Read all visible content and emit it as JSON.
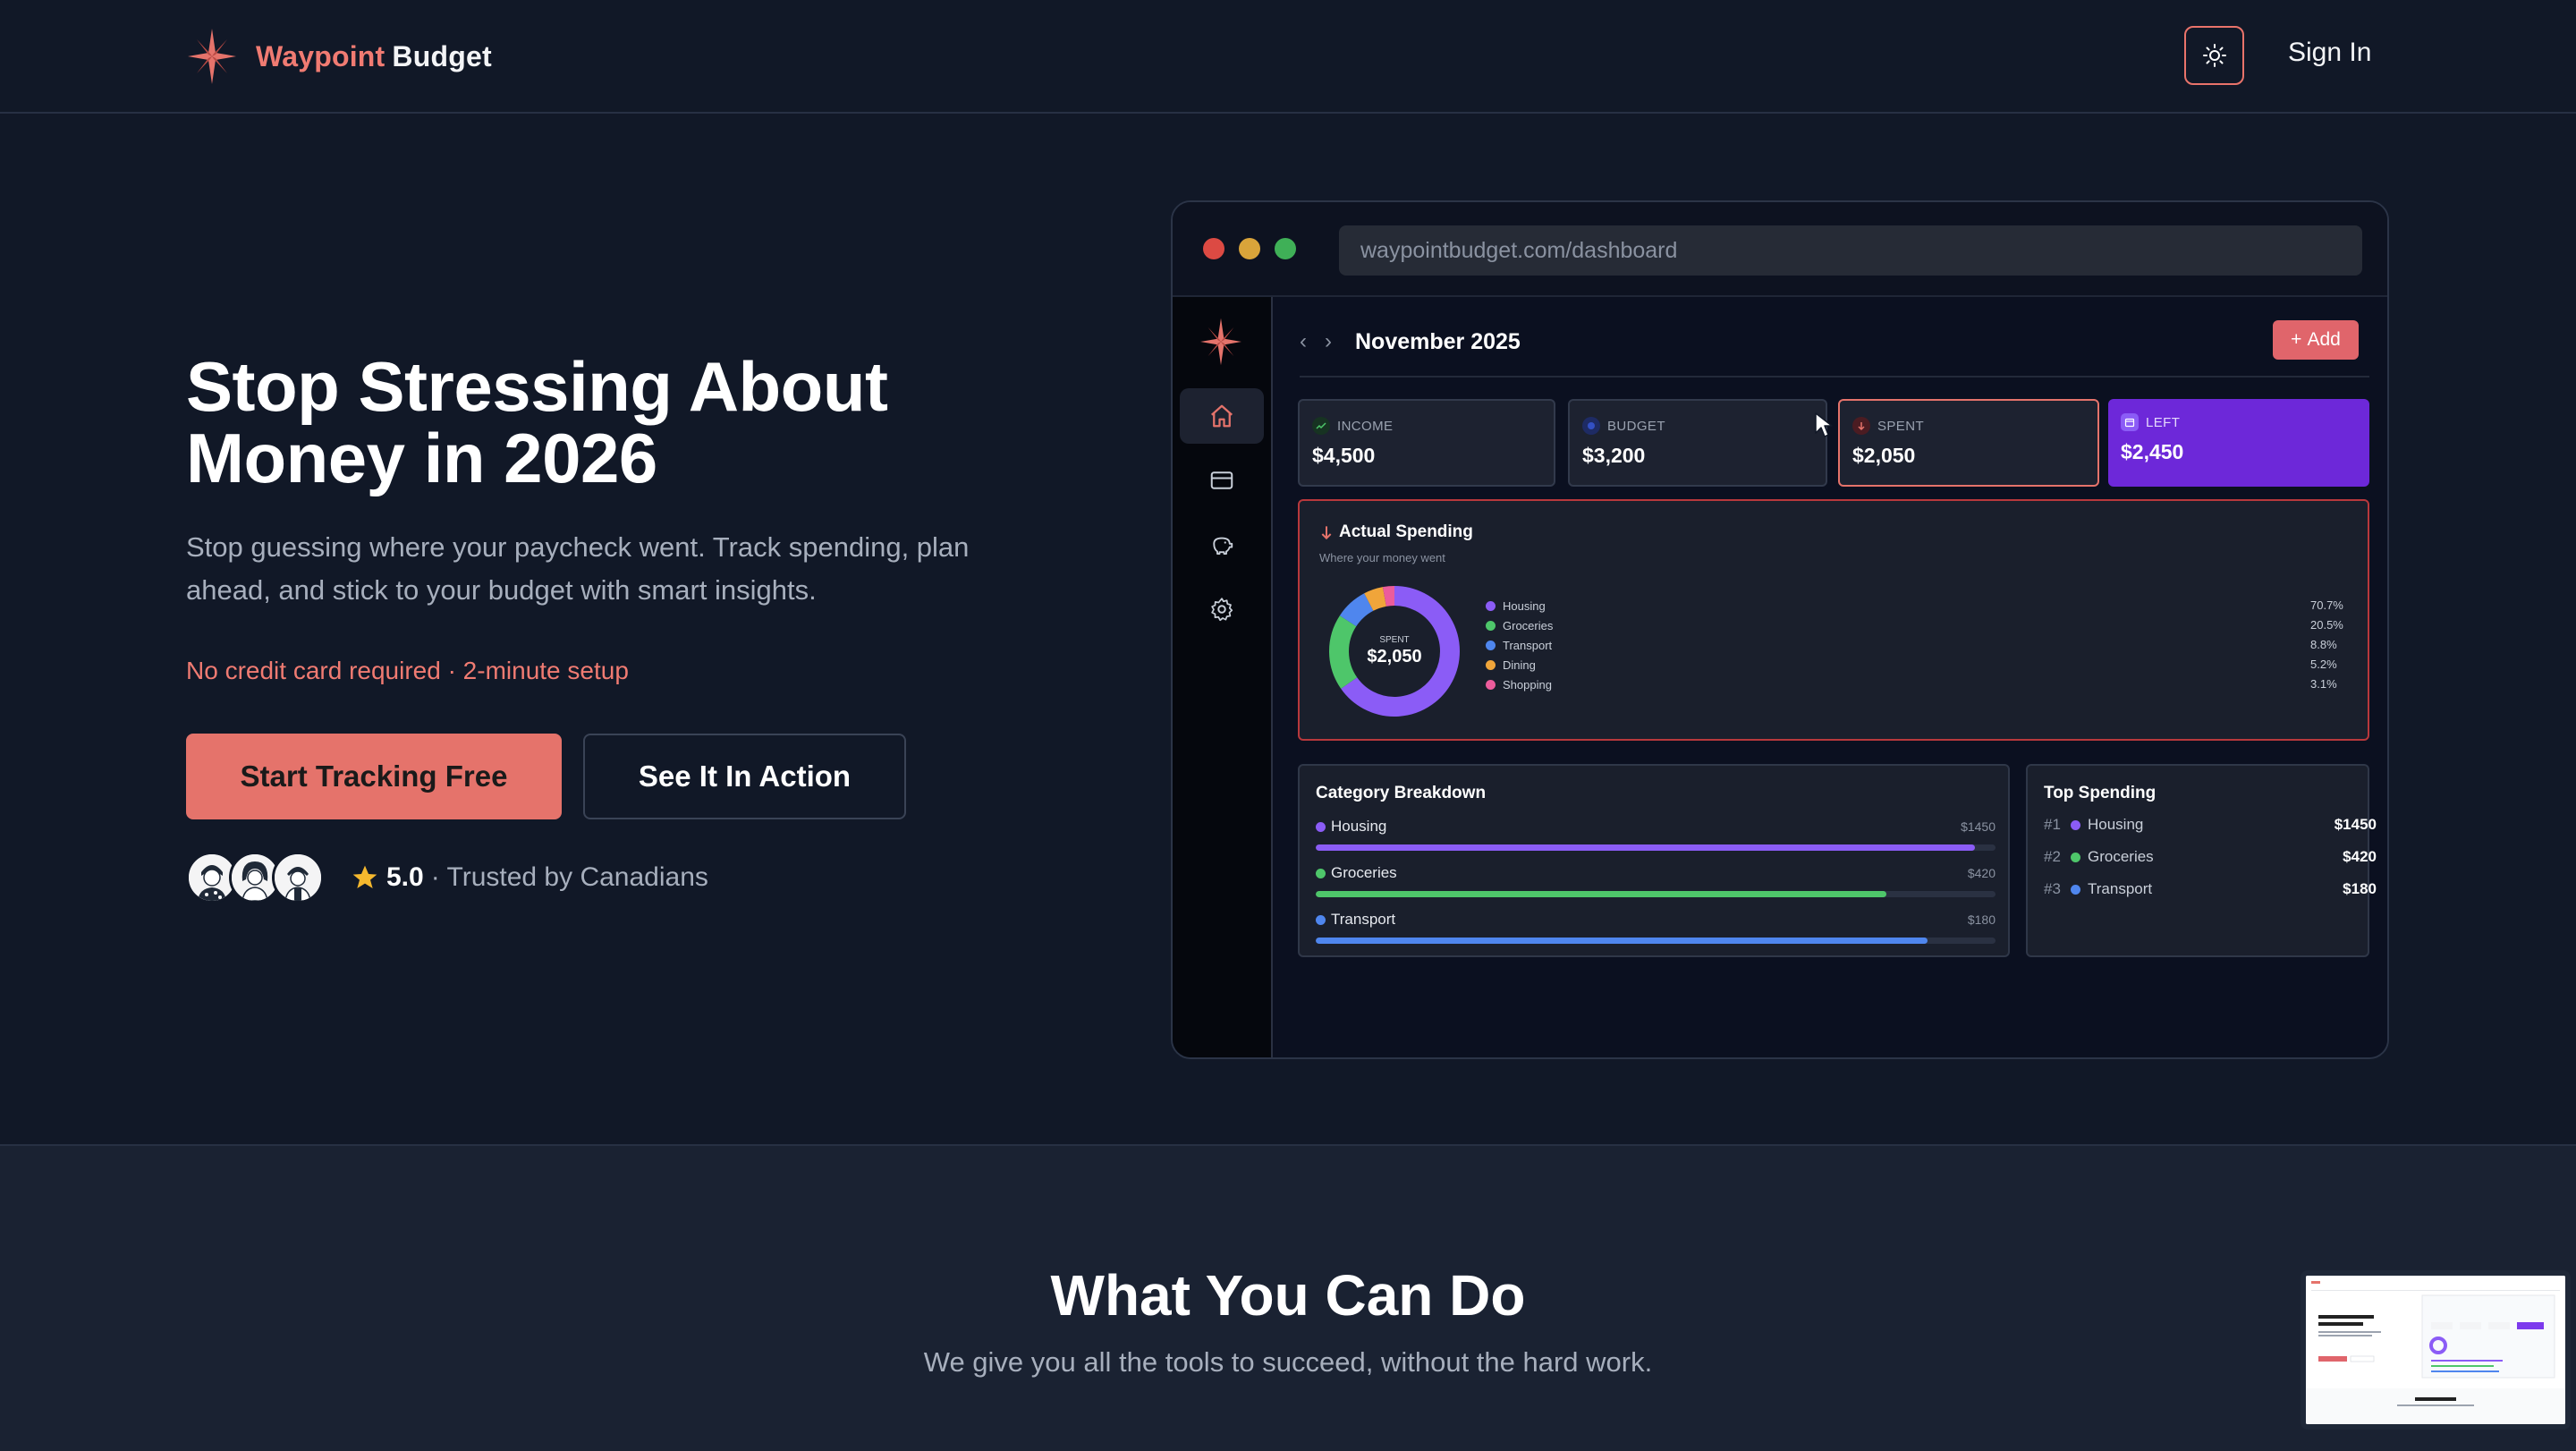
{
  "nav": {
    "brand_accent": "Waypoint",
    "brand_rest": "Budget",
    "signin_label": "Sign In"
  },
  "hero": {
    "title": "Stop Stressing About Money in 2026",
    "subtitle": "Stop guessing where your paycheck went. Track spending, plan ahead, and stick to your budget with smart insights.",
    "note": "No credit card required · 2-minute setup",
    "primary_cta": "Start Tracking Free",
    "secondary_cta": "See It In Action",
    "rating": "5.0",
    "trust_text": "· Trusted by Canadians"
  },
  "mock": {
    "url": "waypointbudget.com/dashboard",
    "month": "November 2025",
    "add_label": "Add",
    "stats": [
      {
        "label": "INCOME",
        "value": "$4,500"
      },
      {
        "label": "BUDGET",
        "value": "$3,200"
      },
      {
        "label": "SPENT",
        "value": "$2,050"
      },
      {
        "label": "LEFT",
        "value": "$2,450"
      }
    ],
    "spending": {
      "title": "Actual Spending",
      "subtitle": "Where your money went",
      "center_label": "SPENT",
      "center_value": "$2,050",
      "legend": [
        {
          "name": "Housing",
          "pct": "70.7%",
          "share": 70.7,
          "color": "#8b5cf6"
        },
        {
          "name": "Groceries",
          "pct": "20.5%",
          "share": 20.5,
          "color": "#4ec66a"
        },
        {
          "name": "Transport",
          "pct": "8.8%",
          "share": 8.8,
          "color": "#4f86ee"
        },
        {
          "name": "Dining",
          "pct": "5.2%",
          "share": 5.2,
          "color": "#f0a53a"
        },
        {
          "name": "Shopping",
          "pct": "3.1%",
          "share": 3.1,
          "color": "#ec5c9c"
        }
      ]
    },
    "category": {
      "title": "Category Breakdown",
      "items": [
        {
          "name": "Housing",
          "amount": "$1450",
          "fill": 0.97,
          "color": "#8b5cf6"
        },
        {
          "name": "Groceries",
          "amount": "$420",
          "fill": 0.84,
          "color": "#4ec66a"
        },
        {
          "name": "Transport",
          "amount": "$180",
          "fill": 0.9,
          "color": "#4f86ee"
        }
      ]
    },
    "top": {
      "title": "Top Spending",
      "items": [
        {
          "rank": "#1",
          "name": "Housing",
          "amount": "$1450",
          "color": "#8b5cf6"
        },
        {
          "rank": "#2",
          "name": "Groceries",
          "amount": "$420",
          "color": "#4ec66a"
        },
        {
          "rank": "#3",
          "name": "Transport",
          "amount": "$180",
          "color": "#4f86ee"
        }
      ]
    }
  },
  "features": {
    "title": "What You Can Do",
    "subtitle": "We give you all the tools to succeed, without the hard work."
  },
  "colors": {
    "accent": "#e5736b",
    "background": "#111827",
    "left_card": "#6d28d9"
  }
}
